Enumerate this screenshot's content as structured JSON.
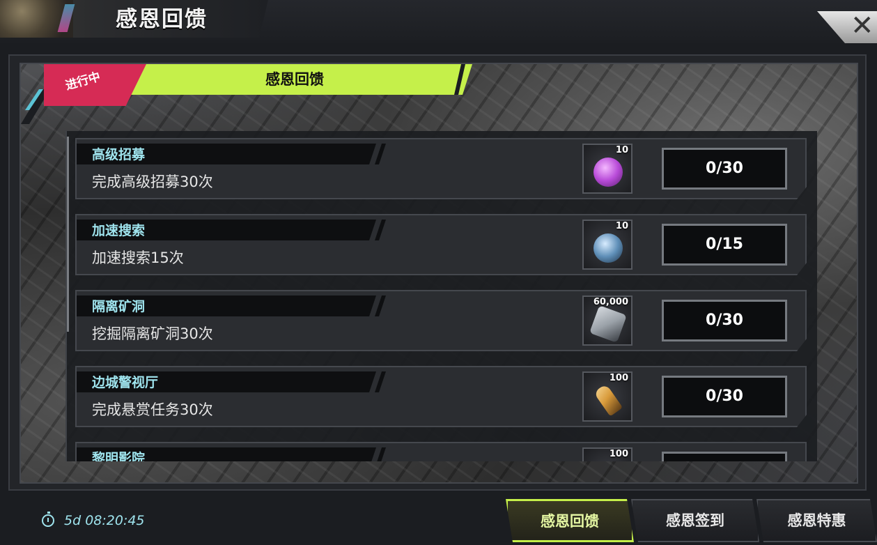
{
  "window": {
    "title": "感恩回馈"
  },
  "event": {
    "status_badge": "进行中",
    "banner_title": "感恩回馈"
  },
  "tasks": [
    {
      "title": "高级招募",
      "description": "完成高级招募30次",
      "reward_count": "10",
      "progress": "0/30",
      "reward_color": "#b84bd8"
    },
    {
      "title": "加速搜索",
      "description": "加速搜索15次",
      "reward_count": "10",
      "progress": "0/15",
      "reward_color": "#5f8fb8"
    },
    {
      "title": "隔离矿洞",
      "description": "挖掘隔离矿洞30次",
      "reward_count": "60,000",
      "progress": "0/30",
      "reward_color": "#9aa1a8"
    },
    {
      "title": "边城警视厅",
      "description": "完成悬赏任务30次",
      "reward_count": "100",
      "progress": "0/30",
      "reward_color": "#d89a3a"
    },
    {
      "title": "黎明影院",
      "description": "",
      "reward_count": "100",
      "progress": "",
      "reward_color": "#4a6a9a"
    }
  ],
  "footer": {
    "timer": "5d 08:20:45",
    "tabs": [
      "感恩回馈",
      "感恩签到",
      "感恩特惠"
    ],
    "active_tab": 0
  },
  "colors": {
    "accent_green": "#c5f04a",
    "badge_red": "#d62b55",
    "title_cyan": "#9fe4ee"
  }
}
